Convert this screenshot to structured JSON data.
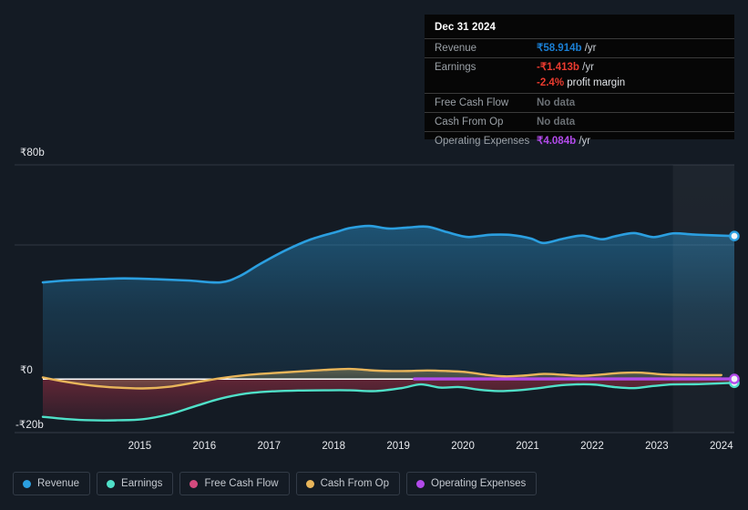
{
  "colors": {
    "background": "#141b24",
    "revenue": "#2b9fe0",
    "earnings": "#4fe0c8",
    "free_cash_flow": "#d44a7e",
    "cash_from_op": "#e8b55a",
    "operating_expenses": "#b24aea",
    "zero_line": "#ffffff",
    "gridline": "#39414c",
    "tooltip_bg": "#060606"
  },
  "tooltip": {
    "title": "Dec 31 2024",
    "rows": [
      {
        "label": "Revenue",
        "amount": "₹58.914b",
        "unit": " /yr",
        "style": "amt-rev"
      },
      {
        "label": "Earnings",
        "amount": "-₹1.413b",
        "unit": " /yr",
        "style": "amt-neg"
      },
      {
        "label": "",
        "amount": "-2.4%",
        "unit": " profit margin",
        "style": "amt-neg",
        "sub": true
      },
      {
        "label": "Free Cash Flow",
        "amount": "No data",
        "unit": "",
        "style": "nodata"
      },
      {
        "label": "Cash From Op",
        "amount": "No data",
        "unit": "",
        "style": "nodata"
      },
      {
        "label": "Operating Expenses",
        "amount": "₹4.084b",
        "unit": " /yr",
        "style": "amt-opex"
      }
    ]
  },
  "legend": {
    "items": [
      {
        "label": "Revenue",
        "color": "#2b9fe0"
      },
      {
        "label": "Earnings",
        "color": "#4fe0c8"
      },
      {
        "label": "Free Cash Flow",
        "color": "#d44a7e"
      },
      {
        "label": "Cash From Op",
        "color": "#e8b55a"
      },
      {
        "label": "Operating Expenses",
        "color": "#b24aea"
      }
    ]
  },
  "chart_data": {
    "type": "area",
    "title": "",
    "xlabel": "",
    "ylabel": "",
    "currency": "₹",
    "units": "billions",
    "ylim": [
      -20,
      80
    ],
    "y_ticks": [
      {
        "value": 80,
        "label": "₹80b"
      },
      {
        "value": 0,
        "label": "₹0"
      },
      {
        "value": -20,
        "label": "-₹20b"
      }
    ],
    "gridlines": [
      80,
      50,
      0,
      -20
    ],
    "zero_line": 0,
    "grid": true,
    "legend_position": "bottom-left",
    "x_ticks": [
      "2015",
      "2016",
      "2017",
      "2018",
      "2019",
      "2020",
      "2021",
      "2022",
      "2023",
      "2024"
    ],
    "x_range": [
      "2014.25",
      "2024.95"
    ],
    "highlight_band": {
      "from": "2024.0",
      "to": "2024.95"
    },
    "series": [
      {
        "name": "Revenue",
        "color": "#2b9fe0",
        "x": [
          2014.25,
          2014.6,
          2015.0,
          2015.5,
          2016.0,
          2016.5,
          2017.0,
          2017.3,
          2017.6,
          2018.0,
          2018.4,
          2018.8,
          2019.0,
          2019.3,
          2019.6,
          2019.9,
          2020.2,
          2020.5,
          2020.8,
          2021.0,
          2021.2,
          2021.5,
          2021.8,
          2022.0,
          2022.3,
          2022.6,
          2022.9,
          2023.1,
          2023.4,
          2023.7,
          2024.0,
          2024.3,
          2024.6,
          2024.95
        ],
        "values": [
          36.1,
          36.8,
          37.2,
          37.6,
          37.3,
          36.8,
          36.1,
          38.5,
          42.8,
          48.0,
          52.2,
          55.0,
          56.4,
          57.2,
          56.2,
          56.6,
          56.9,
          54.9,
          53.1,
          53.4,
          53.9,
          53.8,
          52.5,
          50.8,
          52.4,
          53.6,
          52.2,
          53.3,
          54.5,
          53.0,
          54.4,
          54.0,
          53.7,
          53.4
        ],
        "end_marker": true
      },
      {
        "name": "Earnings",
        "color": "#4fe0c8",
        "x": [
          2014.25,
          2014.6,
          2015.0,
          2015.4,
          2015.8,
          2016.2,
          2016.6,
          2017.0,
          2017.4,
          2017.8,
          2018.2,
          2018.6,
          2019.0,
          2019.4,
          2019.8,
          2020.1,
          2020.4,
          2020.7,
          2021.0,
          2021.3,
          2021.6,
          2021.9,
          2022.2,
          2022.5,
          2022.8,
          2023.1,
          2023.4,
          2023.7,
          2024.0,
          2024.4,
          2024.95
        ],
        "values": [
          -14.1,
          -14.9,
          -15.4,
          -15.4,
          -15.0,
          -13.2,
          -10.2,
          -7.3,
          -5.4,
          -4.6,
          -4.3,
          -4.2,
          -4.2,
          -4.5,
          -3.4,
          -2.0,
          -3.2,
          -3.0,
          -4.0,
          -4.5,
          -4.2,
          -3.5,
          -2.5,
          -2.0,
          -2.1,
          -3.0,
          -3.4,
          -2.6,
          -2.0,
          -1.9,
          -1.4
        ],
        "end_marker": true
      },
      {
        "name": "Free Cash Flow",
        "color": "#d44a7e",
        "x": [],
        "values": [],
        "no_data": true
      },
      {
        "name": "Cash From Op",
        "color": "#e8b55a",
        "x": [
          2014.25,
          2014.6,
          2015.0,
          2015.4,
          2015.8,
          2016.2,
          2016.6,
          2017.0,
          2017.4,
          2017.8,
          2018.2,
          2018.6,
          2019.0,
          2019.3,
          2019.6,
          2019.9,
          2020.2,
          2020.5,
          2020.8,
          2021.1,
          2021.4,
          2021.7,
          2022.0,
          2022.3,
          2022.6,
          2022.9,
          2023.2,
          2023.5,
          2023.8,
          2024.0,
          2024.5,
          2024.75
        ],
        "values": [
          0.6,
          -1.0,
          -2.4,
          -3.2,
          -3.5,
          -2.9,
          -1.3,
          0.3,
          1.5,
          2.2,
          2.8,
          3.4,
          3.8,
          3.3,
          3.0,
          3.0,
          3.2,
          3.0,
          2.6,
          1.6,
          1.0,
          1.3,
          1.9,
          1.6,
          1.2,
          1.7,
          2.3,
          2.4,
          1.8,
          1.6,
          1.5,
          1.5
        ],
        "end_marker": false
      },
      {
        "name": "Operating Expenses",
        "color": "#b24aea",
        "x": [
          2020.0,
          2020.6,
          2021.2,
          2021.8,
          2022.4,
          2023.0,
          2023.6,
          2024.2,
          2024.95
        ],
        "values": [
          0.05,
          0.05,
          0.05,
          0.05,
          0.05,
          0.05,
          0.05,
          0.05,
          0.05
        ],
        "end_marker": true
      }
    ]
  }
}
